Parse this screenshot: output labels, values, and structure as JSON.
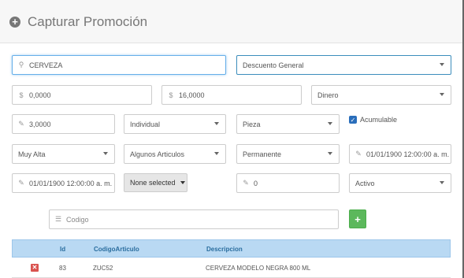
{
  "header": {
    "title": "Capturar Promoción",
    "icon": "plus-circle-icon"
  },
  "row1": {
    "search_value": "CERVEZA",
    "discount_type": "Descuento General"
  },
  "row2": {
    "min_amount": "0,0000",
    "amount": "16,0000",
    "currency_type": "Dinero",
    "currency_symbol": "$"
  },
  "row3": {
    "quantity": "3,0000",
    "scope": "Individual",
    "unit": "Pieza",
    "accumulable_label": "Acumulable",
    "accumulable_checked": true
  },
  "row4": {
    "priority": "Muy Alta",
    "articles": "Algunos Articulos",
    "duration": "Permanente",
    "start_date": "01/01/1900 12:00:00 a. m."
  },
  "row5": {
    "end_date": "01/01/1900 12:00:00 a. m.",
    "multiselect": "None selected",
    "counter": "0",
    "status": "Activo"
  },
  "code_row": {
    "placeholder": "Codigo",
    "add_label": "+"
  },
  "table": {
    "headers": [
      "Id",
      "CodigoArticulo",
      "Descripcion"
    ],
    "rows": [
      {
        "id": "83",
        "code": "ZUC52",
        "description": "CERVEZA MODELO NEGRA 800 ML"
      }
    ]
  }
}
